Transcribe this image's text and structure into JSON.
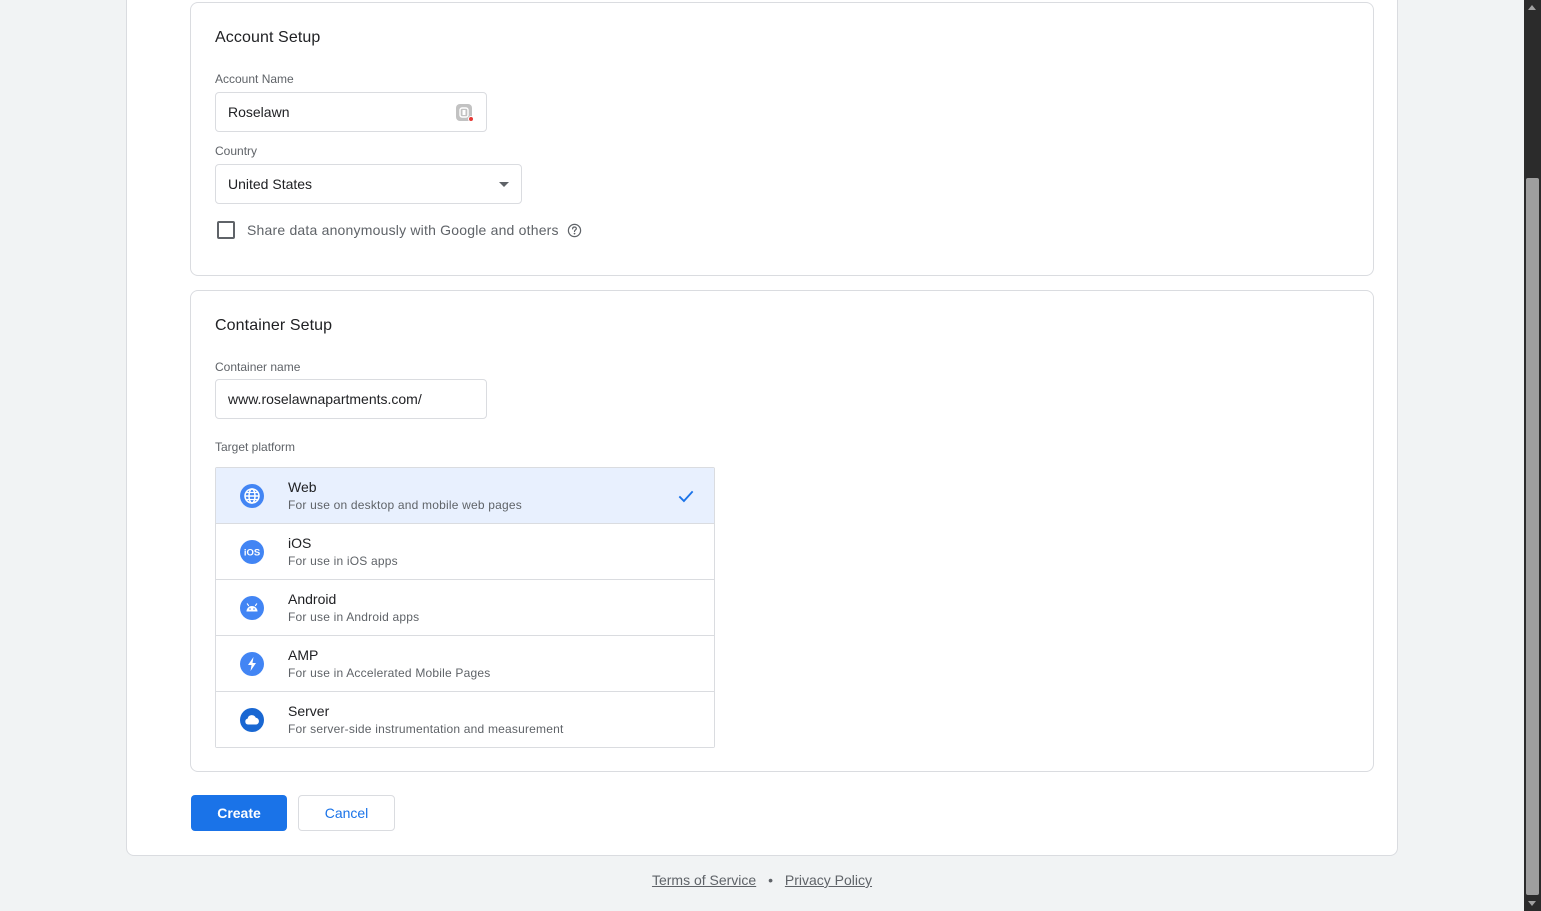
{
  "account_setup": {
    "title": "Account Setup",
    "account_name_label": "Account Name",
    "account_name_value": "Roselawn",
    "country_label": "Country",
    "country_value": "United States",
    "share_data_label": "Share data anonymously with Google and others",
    "share_data_checked": false
  },
  "container_setup": {
    "title": "Container Setup",
    "container_name_label": "Container name",
    "container_name_value": "www.roselawnapartments.com/",
    "target_platform_label": "Target platform",
    "selected_platform": "Web",
    "platforms": [
      {
        "name": "Web",
        "description": "For use on desktop and mobile web pages",
        "icon": "globe-icon"
      },
      {
        "name": "iOS",
        "description": "For use in iOS apps",
        "icon": "ios-icon"
      },
      {
        "name": "Android",
        "description": "For use in Android apps",
        "icon": "android-icon"
      },
      {
        "name": "AMP",
        "description": "For use in Accelerated Mobile Pages",
        "icon": "lightning-icon"
      },
      {
        "name": "Server",
        "description": "For server-side instrumentation and measurement",
        "icon": "cloud-icon"
      }
    ]
  },
  "actions": {
    "create_label": "Create",
    "cancel_label": "Cancel"
  },
  "footer": {
    "terms_label": "Terms of Service",
    "separator": "•",
    "privacy_label": "Privacy Policy"
  },
  "colors": {
    "accent": "#1a73e8",
    "selected_bg": "#e8f0fe",
    "border": "#dadce0",
    "page_bg": "#f1f3f4"
  }
}
